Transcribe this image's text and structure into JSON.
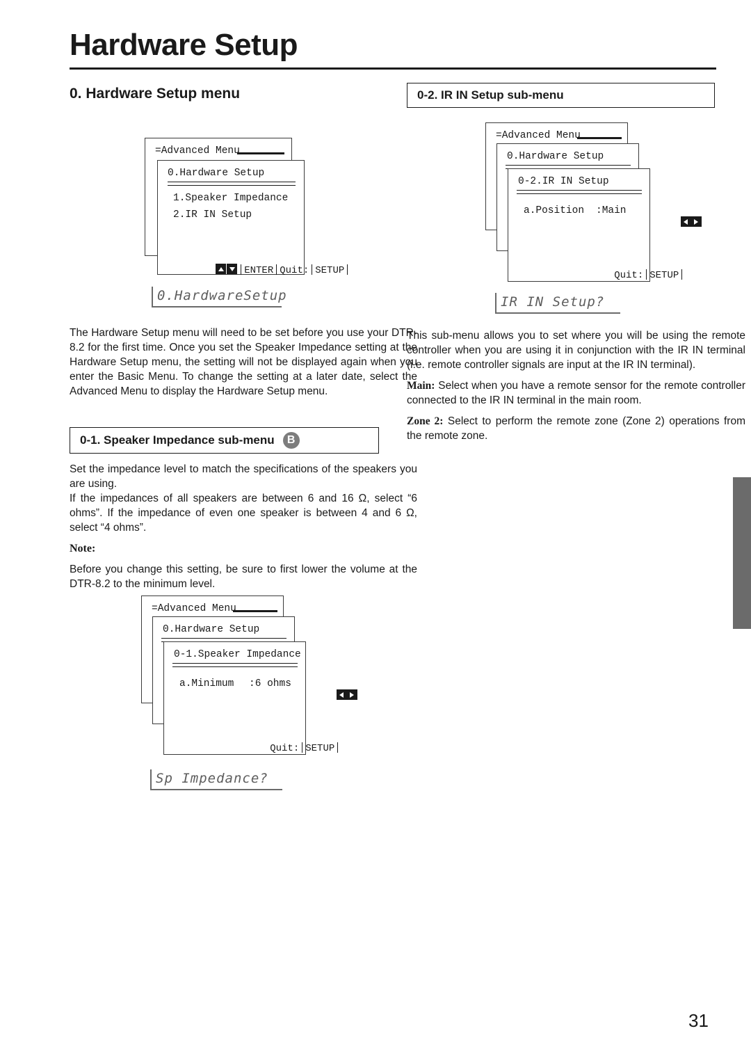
{
  "page": {
    "title": "Hardware Setup",
    "number": "31"
  },
  "sections": {
    "hardware_setup_menu": {
      "heading": "0. Hardware Setup menu",
      "body": "The Hardware Setup menu will need to be set before you use your DTR-8.2 for the first time. Once you set the Speaker Impedance setting at the Hardware Setup menu, the setting will not be displayed again when you enter the Basic Menu. To change the setting at a later date, select the Advanced Menu to display the Hardware Setup menu."
    },
    "speaker_impedance": {
      "heading": "0-1.  Speaker Impedance sub-menu",
      "badge": "B",
      "para1": "Set the impedance level to match the specifications of the speakers you are using.",
      "para2": "If the impedances of all speakers are between 6 and 16 Ω, select “6 ohms”. If the impedance of even one speaker is between 4 and 6 Ω, select “4 ohms”.",
      "note_label": "Note:",
      "note_body": "Before you change this setting, be sure to first lower the volume at the DTR-8.2 to the minimum level."
    },
    "ir_in_setup": {
      "heading": "0-2. IR IN Setup sub-menu",
      "para1": "This sub-menu allows you to set where you will be using the remote controller when you are using it in conjunction with the IR IN terminal (i.e. remote controller signals are input at the IR IN terminal).",
      "main_label": "Main:",
      "main_body": "Select when you have a remote sensor for the remote controller connected to the IR IN terminal in the main room.",
      "zone_label": "Zone 2:",
      "zone_body": "Select to perform the remote zone (Zone 2) operations from the remote zone."
    }
  },
  "diagrams": {
    "hardware_setup": {
      "window_back_title": "=Advanced Menu",
      "window_front_title": "0.Hardware Setup",
      "items": [
        "1.Speaker Impedance",
        "2.IR IN Setup"
      ],
      "footer": {
        "enter": "ENTER",
        "quit": "Quit:",
        "setup": "SETUP"
      },
      "lcd": "0.HardwareSetup"
    },
    "ir_in_setup": {
      "window_back_title": "=Advanced Menu",
      "window_mid_title": "0.Hardware Setup",
      "window_front_title": "0-2.IR IN Setup",
      "setting_label": "a.Position",
      "setting_value": ":Main",
      "footer": {
        "quit": "Quit:",
        "setup": "SETUP"
      },
      "lcd": "IR IN Setup?"
    },
    "speaker_impedance": {
      "window_back_title": "=Advanced Menu",
      "window_mid_title": "0.Hardware Setup",
      "window_front_title": "0-1.Speaker Impedance",
      "setting_label": "a.Minimum",
      "setting_value": ":6 ohms",
      "footer": {
        "quit": "Quit:",
        "setup": "SETUP"
      },
      "lcd": "Sp Impedance?"
    }
  },
  "colors": {
    "ink": "#1a1a1a",
    "lcd": "#5d5d5d",
    "badge": "#7d7d7d",
    "edge_tab": "#6b6b6b"
  }
}
